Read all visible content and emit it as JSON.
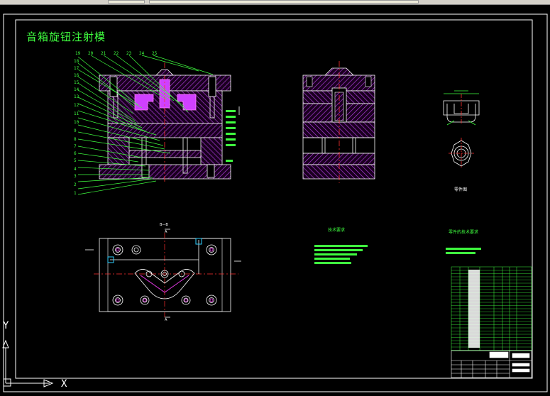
{
  "window": {
    "title_fragment": ""
  },
  "drawing": {
    "title": "音箱旋钮注射模",
    "labels": {
      "view_b_b": "B—B",
      "view_a_top": "A",
      "view_a_bottom": "A",
      "tech_req_1": "技术要求",
      "tech_req_2": "零件的技术要求",
      "part_view": "零件图"
    },
    "part_numbers_left": [
      "19",
      "20",
      "21",
      "22",
      "23",
      "24",
      "25"
    ],
    "part_numbers_side": [
      "18",
      "17",
      "16",
      "15",
      "14",
      "13",
      "12",
      "11",
      "10",
      "9",
      "8",
      "7",
      "6",
      "5",
      "4",
      "3",
      "2",
      "1"
    ]
  },
  "ucs": {
    "x_label": "X",
    "y_label": "Y"
  },
  "colors": {
    "background": "#000000",
    "line": "#ffffff",
    "leader": "#3fff3f",
    "hatch": "#c040ff",
    "magenta": "#ff40ff",
    "centerline": "#ff3030",
    "cyan": "#30d0ff"
  }
}
